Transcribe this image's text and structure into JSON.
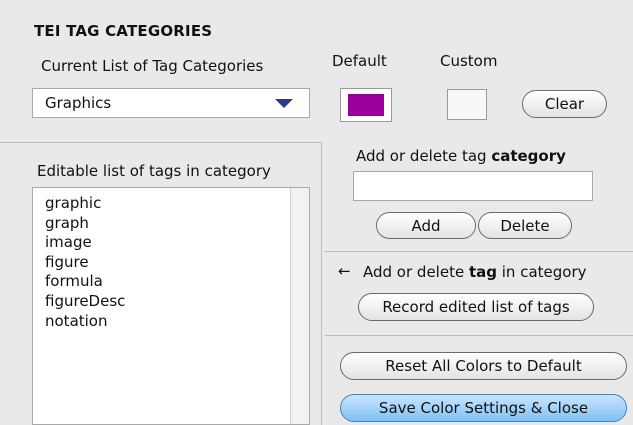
{
  "window": {
    "title": "TEI TAG CATEGORIES"
  },
  "category": {
    "label": "Current List of Tag Categories",
    "selected": "Graphics"
  },
  "colors": {
    "default_label": "Default",
    "custom_label": "Custom",
    "default_color": "#9b009b",
    "custom_color": "#f7f7f7",
    "clear_label": "Clear"
  },
  "tags": {
    "header": "Editable list of tags in category",
    "items": [
      "graphic",
      "graph",
      "image",
      "figure",
      "formula",
      "figureDesc",
      "notation"
    ]
  },
  "category_editor": {
    "heading_prefix": "Add or delete tag ",
    "heading_bold": "category",
    "input_value": "",
    "add_label": "Add",
    "delete_label": "Delete"
  },
  "tag_editor": {
    "arrow": "←",
    "heading_prefix": "Add or delete ",
    "heading_bold": "tag",
    "heading_suffix": " in category",
    "record_label": "Record edited list of tags"
  },
  "footer": {
    "reset_label": "Reset All Colors to Default",
    "save_label": "Save Color Settings & Close"
  }
}
